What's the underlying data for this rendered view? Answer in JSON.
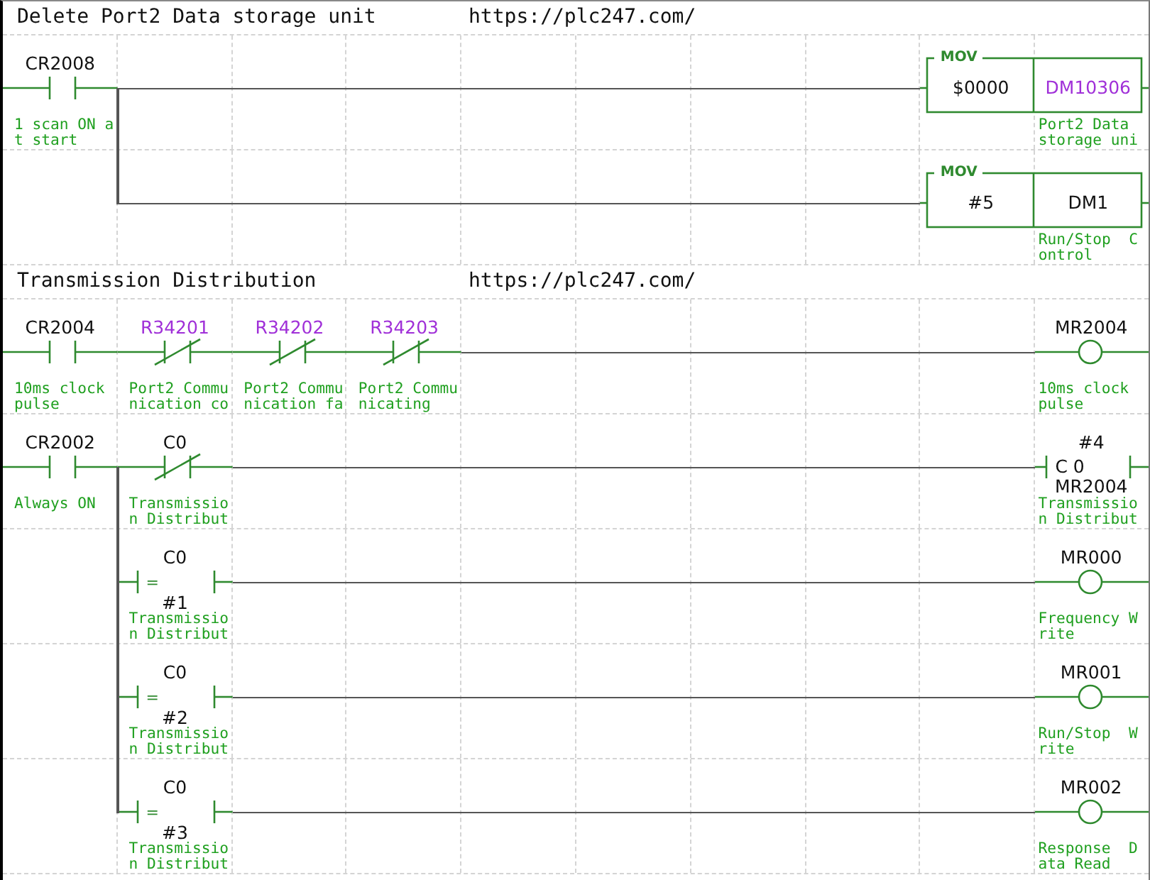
{
  "rungs": [
    {
      "title": "Delete Port2 Data storage unit",
      "url": "https://plc247.com/",
      "rows": [
        {
          "branch": false,
          "cells": [
            {
              "kind": "contact_no",
              "device": "CR2008",
              "comment": "1 scan ON at start"
            },
            {
              "kind": "wire"
            },
            {
              "kind": "wire"
            },
            {
              "kind": "wire"
            },
            {
              "kind": "wire"
            },
            {
              "kind": "wire"
            },
            {
              "kind": "wire"
            },
            {
              "kind": "wire"
            },
            {
              "kind": "mov",
              "instruction": "MOV",
              "source": "$0000",
              "dest": "DM10306",
              "color": "#a030d8",
              "comment": "Port2 Data storage uni"
            }
          ]
        },
        {
          "branch": true,
          "cells": [
            {
              "kind": "empty"
            },
            {
              "kind": "wire"
            },
            {
              "kind": "wire"
            },
            {
              "kind": "wire"
            },
            {
              "kind": "wire"
            },
            {
              "kind": "wire"
            },
            {
              "kind": "wire"
            },
            {
              "kind": "wire"
            },
            {
              "kind": "mov",
              "instruction": "MOV",
              "source": "#5",
              "dest": "DM1",
              "comment": "Run/Stop  Control"
            }
          ]
        }
      ]
    },
    {
      "title": "Transmission Distribution",
      "url": "https://plc247.com/",
      "rows": [
        {
          "branch": false,
          "cells": [
            {
              "kind": "contact_no",
              "device": "CR2004",
              "comment": "10ms clock pulse"
            },
            {
              "kind": "contact_nc",
              "device": "R34201",
              "color": "#a030d8",
              "comment": "Port2 Communication co"
            },
            {
              "kind": "contact_nc",
              "device": "R34202",
              "color": "#a030d8",
              "comment": "Port2 Communication fa"
            },
            {
              "kind": "contact_nc",
              "device": "R34203",
              "color": "#a030d8",
              "comment": "Port2 Communicating"
            },
            {
              "kind": "wire"
            },
            {
              "kind": "wire"
            },
            {
              "kind": "wire"
            },
            {
              "kind": "wire"
            },
            {
              "kind": "wire"
            },
            {
              "kind": "coil",
              "device": "MR2004",
              "comment": "10ms clock pulse"
            }
          ]
        },
        {
          "branch": false,
          "cells": [
            {
              "kind": "contact_no",
              "device": "CR2002",
              "comment": "Always ON"
            },
            {
              "kind": "contact_nc",
              "device": "C0",
              "comment": "Transmission Distribut"
            },
            {
              "kind": "wire"
            },
            {
              "kind": "wire"
            },
            {
              "kind": "wire"
            },
            {
              "kind": "wire"
            },
            {
              "kind": "wire"
            },
            {
              "kind": "wire"
            },
            {
              "kind": "wire"
            },
            {
              "kind": "counter",
              "preset": "#4",
              "device": "C 0",
              "input": "MR2004",
              "comment": "Transmission Distribut"
            }
          ]
        },
        {
          "branch": true,
          "cells": [
            {
              "kind": "empty"
            },
            {
              "kind": "compare",
              "device": "C0",
              "operator": "=",
              "operand": "#1",
              "comment": "Transmission Distribut"
            },
            {
              "kind": "wire"
            },
            {
              "kind": "wire"
            },
            {
              "kind": "wire"
            },
            {
              "kind": "wire"
            },
            {
              "kind": "wire"
            },
            {
              "kind": "wire"
            },
            {
              "kind": "wire"
            },
            {
              "kind": "coil",
              "device": "MR000",
              "comment": "Frequency Write"
            }
          ]
        },
        {
          "branch": true,
          "cells": [
            {
              "kind": "empty"
            },
            {
              "kind": "compare",
              "device": "C0",
              "operator": "=",
              "operand": "#2",
              "comment": "Transmission Distribut"
            },
            {
              "kind": "wire"
            },
            {
              "kind": "wire"
            },
            {
              "kind": "wire"
            },
            {
              "kind": "wire"
            },
            {
              "kind": "wire"
            },
            {
              "kind": "wire"
            },
            {
              "kind": "wire"
            },
            {
              "kind": "coil",
              "device": "MR001",
              "comment": "Run/Stop  Write"
            }
          ]
        },
        {
          "branch": true,
          "cells": [
            {
              "kind": "empty"
            },
            {
              "kind": "compare",
              "device": "C0",
              "operator": "=",
              "operand": "#3",
              "comment": "Transmission Distribut"
            },
            {
              "kind": "wire"
            },
            {
              "kind": "wire"
            },
            {
              "kind": "wire"
            },
            {
              "kind": "wire"
            },
            {
              "kind": "wire"
            },
            {
              "kind": "wire"
            },
            {
              "kind": "wire"
            },
            {
              "kind": "coil",
              "device": "MR002",
              "comment": "Response  Data Read"
            }
          ]
        }
      ]
    }
  ]
}
